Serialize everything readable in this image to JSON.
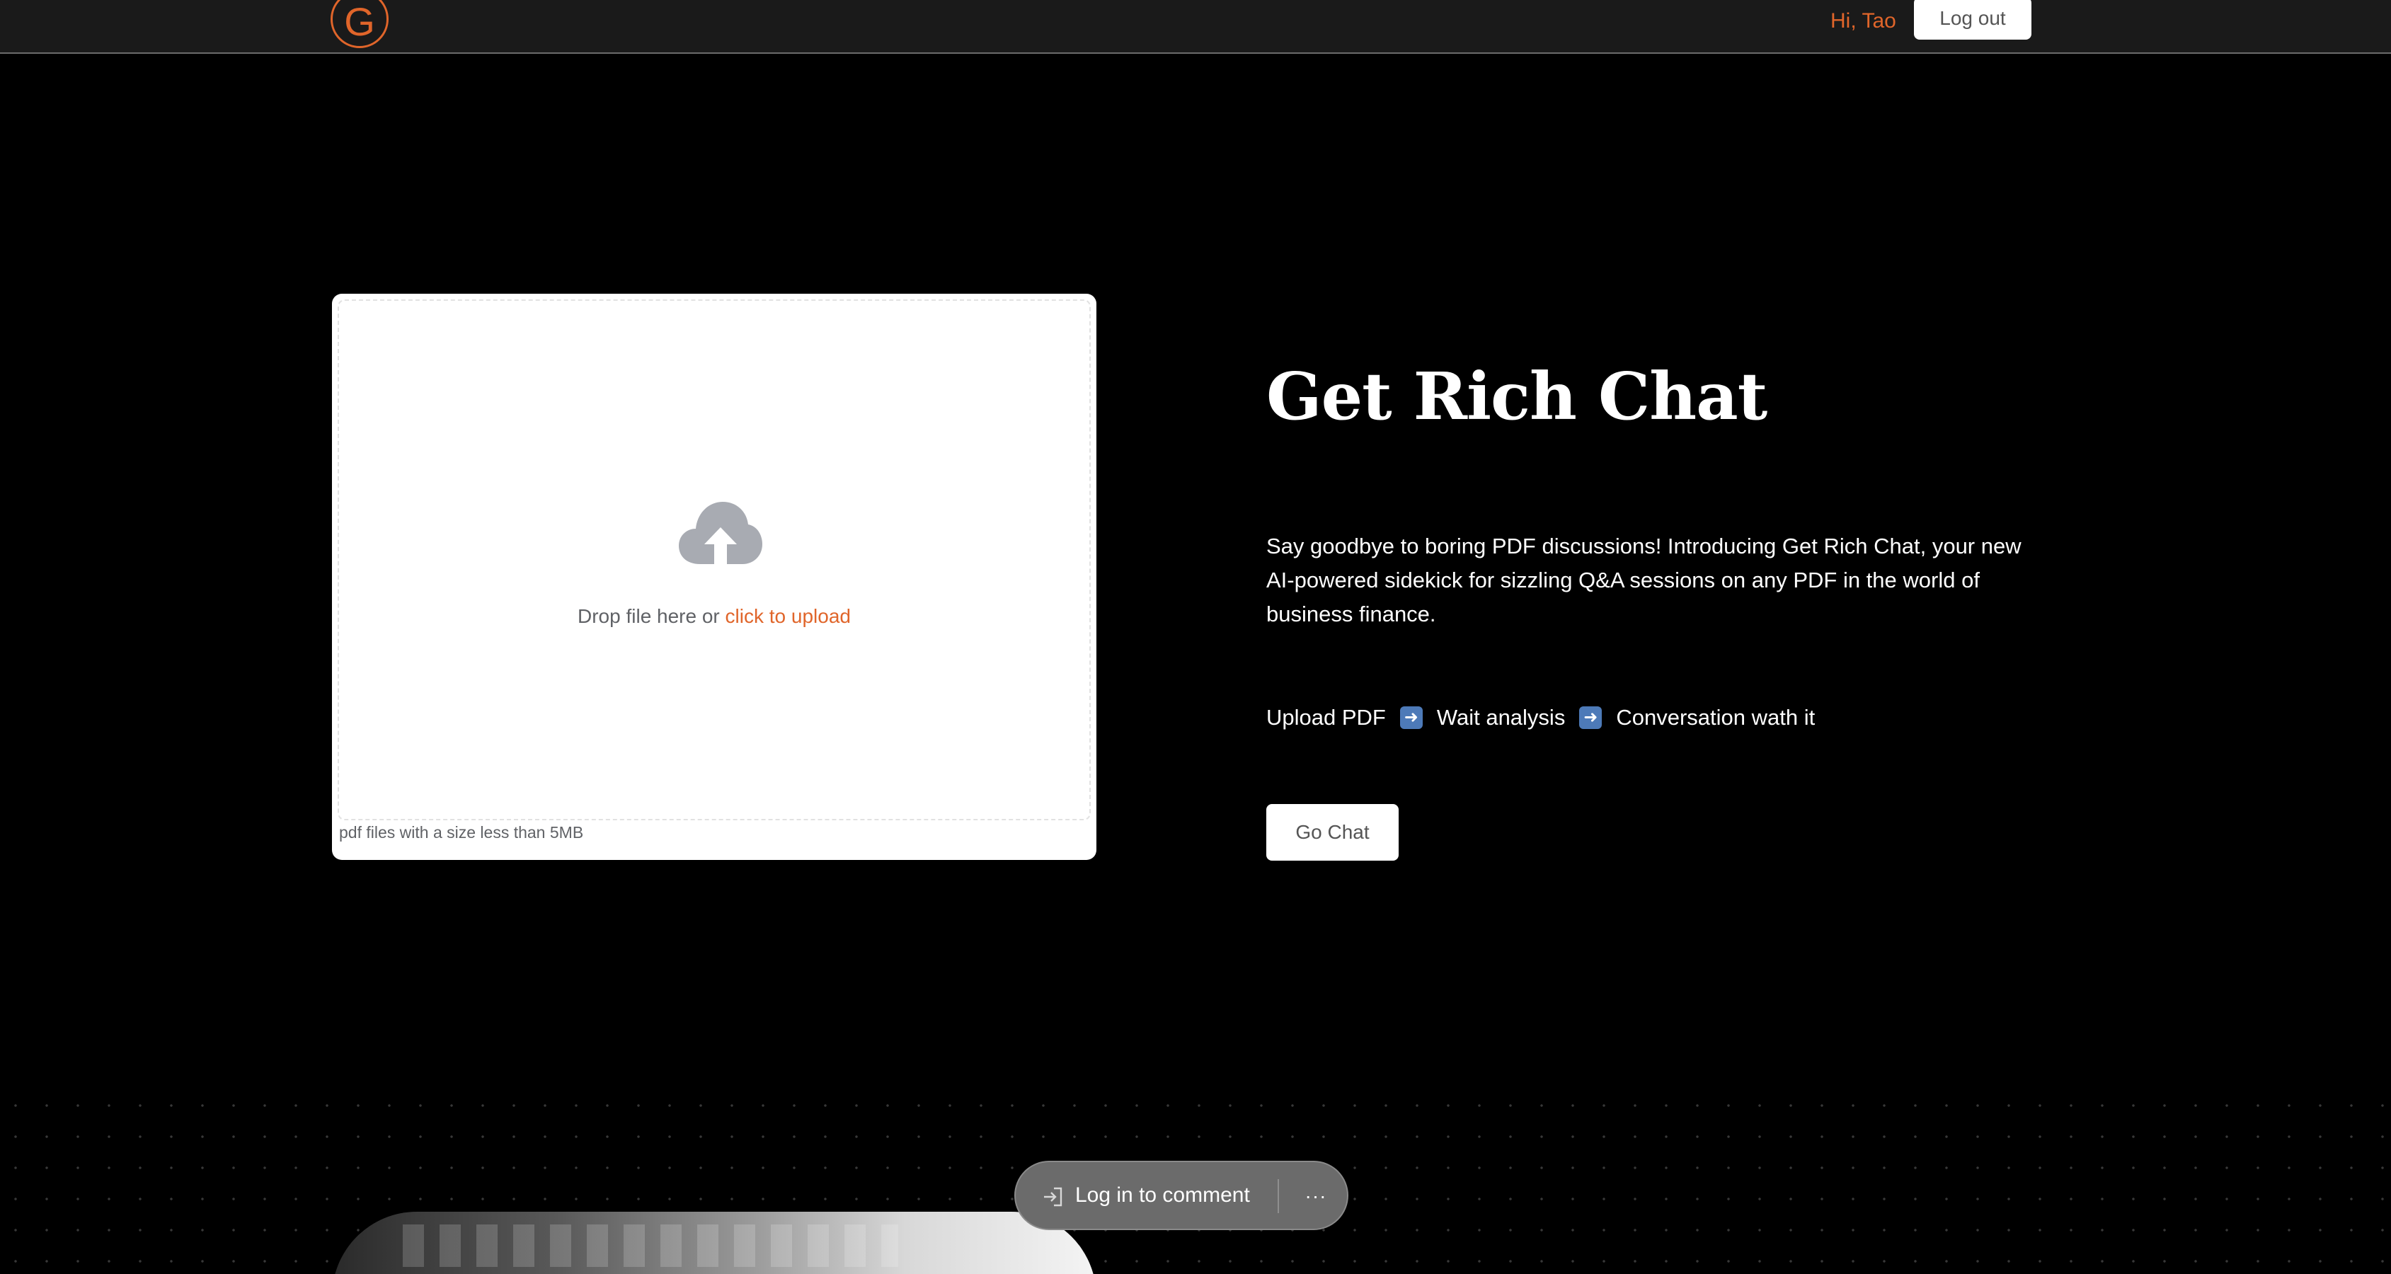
{
  "header": {
    "logo_letter": "G",
    "greeting": "Hi, Tao",
    "logout_label": "Log out"
  },
  "upload": {
    "icon": "cloud-upload-icon",
    "drop_text": "Drop file here or ",
    "click_text": "click to upload",
    "hint": "pdf files with a size less than 5MB"
  },
  "hero": {
    "title": "Get Rich Chat",
    "description": "Say goodbye to boring PDF discussions! Introducing Get Rich Chat, your new AI-powered sidekick for sizzling Q&A sessions on any PDF in the world of business finance.",
    "steps": [
      "Upload PDF",
      "Wait analysis",
      "Conversation wath it"
    ],
    "step_arrow_icon": "right-arrow-icon",
    "go_chat_label": "Go Chat"
  },
  "comment_bar": {
    "label": "Log in to comment",
    "more_label": "···"
  },
  "colors": {
    "accent": "#e0652a",
    "background": "#000000",
    "header": "#1a1a1a"
  }
}
